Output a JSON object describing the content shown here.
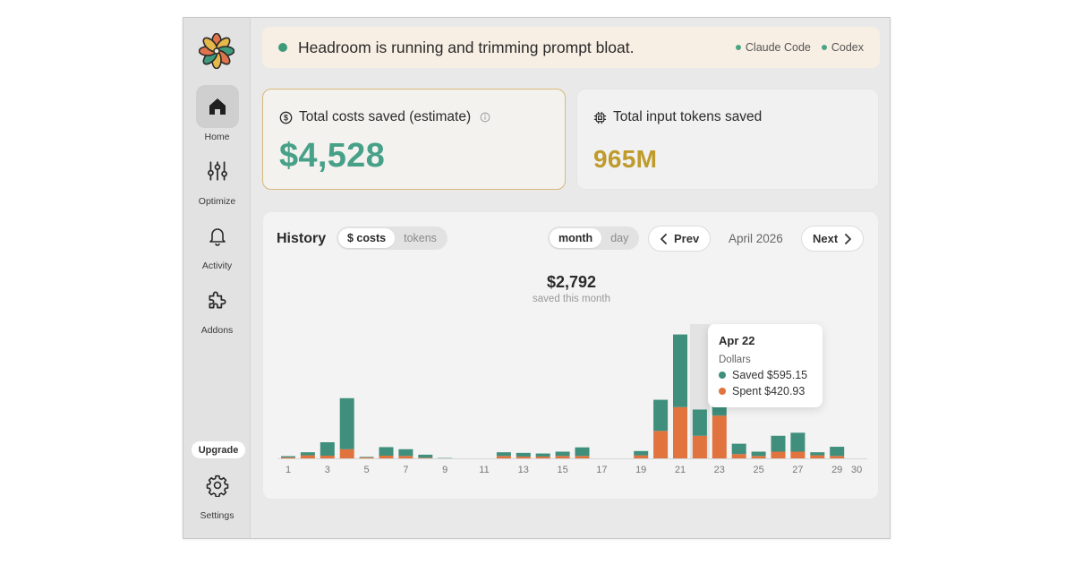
{
  "app": {
    "icons": {
      "logo": "flower-logo-icon"
    }
  },
  "sidebar": {
    "items": [
      {
        "label": "Home",
        "icon": "home-icon",
        "active": true
      },
      {
        "label": "Optimize",
        "icon": "sliders-icon",
        "active": false
      },
      {
        "label": "Activity",
        "icon": "bell-icon",
        "active": false
      },
      {
        "label": "Addons",
        "icon": "puzzle-icon",
        "active": false
      }
    ],
    "upgrade_label": "Upgrade",
    "settings_label": "Settings"
  },
  "banner": {
    "text": "Headroom is running and trimming prompt bloat.",
    "agents": [
      "Claude Code",
      "Codex"
    ],
    "status_color": "#3f9a7b"
  },
  "stats": {
    "costs": {
      "title": "Total costs saved (estimate)",
      "value": "$4,528"
    },
    "tokens": {
      "title": "Total input tokens saved",
      "value": "965M"
    }
  },
  "history": {
    "title": "History",
    "type_toggle": [
      "$ costs",
      "tokens"
    ],
    "type_selected": "$ costs",
    "period_toggle": [
      "month",
      "day"
    ],
    "period_selected": "month",
    "prev_label": "Prev",
    "next_label": "Next",
    "month_label": "April 2026",
    "total_value": "$2,792",
    "total_caption": "saved this month",
    "tooltip": {
      "date": "Apr 22",
      "group": "Dollars",
      "saved": "Saved $595.15",
      "spent": "Spent $420.93"
    }
  },
  "chart_data": {
    "type": "bar",
    "stacked": true,
    "highlighted_day": 22,
    "x": [
      1,
      2,
      3,
      4,
      5,
      6,
      7,
      8,
      9,
      10,
      11,
      12,
      13,
      14,
      15,
      16,
      17,
      18,
      19,
      20,
      21,
      22,
      23,
      24,
      25,
      26,
      27,
      28,
      29,
      30
    ],
    "x_tick_labels": [
      "1",
      "3",
      "5",
      "7",
      "9",
      "11",
      "13",
      "15",
      "17",
      "19",
      "21",
      "23",
      "25",
      "27",
      "29",
      "30"
    ],
    "ylim": [
      0,
      1100
    ],
    "series": [
      {
        "name": "Spent",
        "color": "#e1733f",
        "values": [
          8,
          25,
          22,
          75,
          7,
          22,
          20,
          5,
          0,
          0,
          0,
          20,
          15,
          15,
          20,
          20,
          0,
          0,
          25,
          225,
          420,
          185,
          350,
          35,
          20,
          55,
          55,
          25,
          20,
          0
        ]
      },
      {
        "name": "Saved",
        "color": "#3f8f7c",
        "values": [
          10,
          25,
          110,
          418,
          5,
          70,
          55,
          25,
          3,
          0,
          0,
          30,
          30,
          25,
          35,
          70,
          0,
          0,
          35,
          255,
          595,
          215,
          150,
          85,
          35,
          130,
          155,
          25,
          75,
          0
        ]
      }
    ],
    "grid": false
  }
}
